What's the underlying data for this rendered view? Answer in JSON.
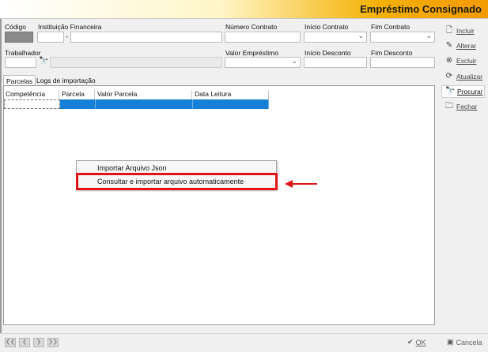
{
  "window": {
    "title": "Empréstimo Consignado"
  },
  "form": {
    "codigo_label": "Código",
    "instituicao_label": "Instituição Financeira",
    "instituicao_sep": "-",
    "numero_contrato_label": "Número Contrato",
    "inicio_contrato_label": "Início Contrato",
    "fim_contrato_label": "Fim Contrato",
    "trabalhador_label": "Trabalhador",
    "valor_emprestimo_label": "Valor Empréstimo",
    "inicio_desconto_label": "Início Desconto",
    "fim_desconto_label": "Fim Desconto"
  },
  "tabs": [
    {
      "label": "Parcelas"
    },
    {
      "label": "Logs de importação"
    }
  ],
  "table": {
    "columns": [
      "Competência",
      "Parcela",
      "Valor Parcela",
      "Data Leitura"
    ]
  },
  "context_menu": {
    "items": [
      {
        "label": "Importar Arquivo Json"
      },
      {
        "label": "Consultar e importar arquivo automaticamente"
      }
    ]
  },
  "sidebar": {
    "buttons": [
      {
        "label": "Incluir",
        "icon": "new-document-icon"
      },
      {
        "label": "Alterar",
        "icon": "pencil-icon"
      },
      {
        "label": "Excluir",
        "icon": "delete-icon"
      },
      {
        "label": "Atualizar",
        "icon": "refresh-icon"
      },
      {
        "label": "Procurar",
        "icon": "binoculars-icon"
      },
      {
        "label": "Fechar",
        "icon": "close-folder-icon"
      }
    ]
  },
  "footer": {
    "ok_label": "OK",
    "cancel_label": "Cancela"
  },
  "colors": {
    "header_accent": "#f39a00",
    "selection": "#1680d8",
    "highlight": "#e01414"
  }
}
